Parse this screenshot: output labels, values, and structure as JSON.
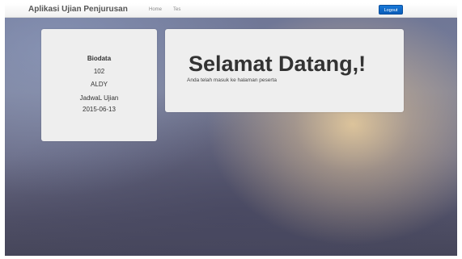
{
  "navbar": {
    "brand": "Aplikasi Ujian Penjurusan",
    "links": [
      {
        "label": "Home"
      },
      {
        "label": "Tes"
      }
    ],
    "logout_label": "Logout",
    "logout_color": "#0f6acb"
  },
  "biodata": {
    "title": "Biodata",
    "number": "102",
    "name": "ALDY",
    "schedule_label": "JadwaL Ujian",
    "date": "2015-06-13"
  },
  "welcome": {
    "heading": "Selamat Datang,!",
    "subtitle": "Anda telah masuk ke halaman peserta"
  }
}
